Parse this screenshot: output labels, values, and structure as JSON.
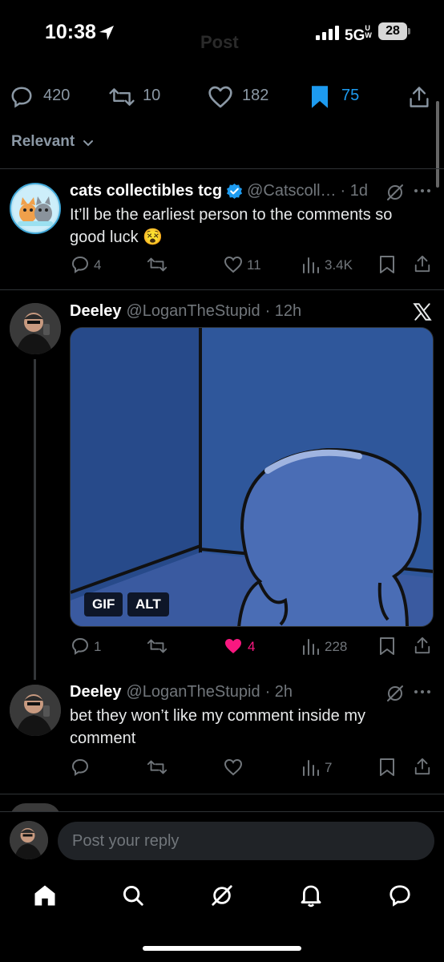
{
  "status_bar": {
    "time": "10:38",
    "network": "5G",
    "network_sub": "UW",
    "battery": "28"
  },
  "header": {
    "title": "Post"
  },
  "engagement": {
    "replies": "420",
    "reposts": "10",
    "likes": "182",
    "bookmarks": "75"
  },
  "sort": {
    "label": "Relevant"
  },
  "posts": [
    {
      "name": "cats collectibles tcg",
      "handle": "@Catscoll…",
      "time": "· 1d",
      "text": "It’ll be the earliest person to the comments so good luck 😵",
      "replies": "4",
      "reposts": "",
      "likes": "11",
      "views": "3.4K"
    },
    {
      "name": "Deeley",
      "handle": "@LoganTheStupid",
      "time": "· 12h",
      "media_badges": [
        "GIF",
        "ALT"
      ],
      "replies": "1",
      "reposts": "",
      "likes": "4",
      "views": "228"
    },
    {
      "name": "Deeley",
      "handle": "@LoganTheStupid",
      "time": "· 2h",
      "text": "bet they won’t like my comment inside my comment",
      "replies": "",
      "reposts": "",
      "likes": "",
      "views": "7"
    }
  ],
  "reply": {
    "placeholder": "Post your reply"
  },
  "colors": {
    "accent": "#1d9bf0",
    "like": "#f91880",
    "muted": "#71767b"
  },
  "icons": [
    "location-arrow-icon",
    "signal-icon",
    "battery-icon",
    "reply-icon",
    "repost-icon",
    "heart-icon",
    "bookmark-icon",
    "share-icon",
    "chevron-down-icon",
    "verified-icon",
    "grok-icon",
    "more-icon",
    "views-icon",
    "x-logo-icon",
    "home-icon",
    "search-icon",
    "notifications-icon",
    "messages-icon"
  ]
}
